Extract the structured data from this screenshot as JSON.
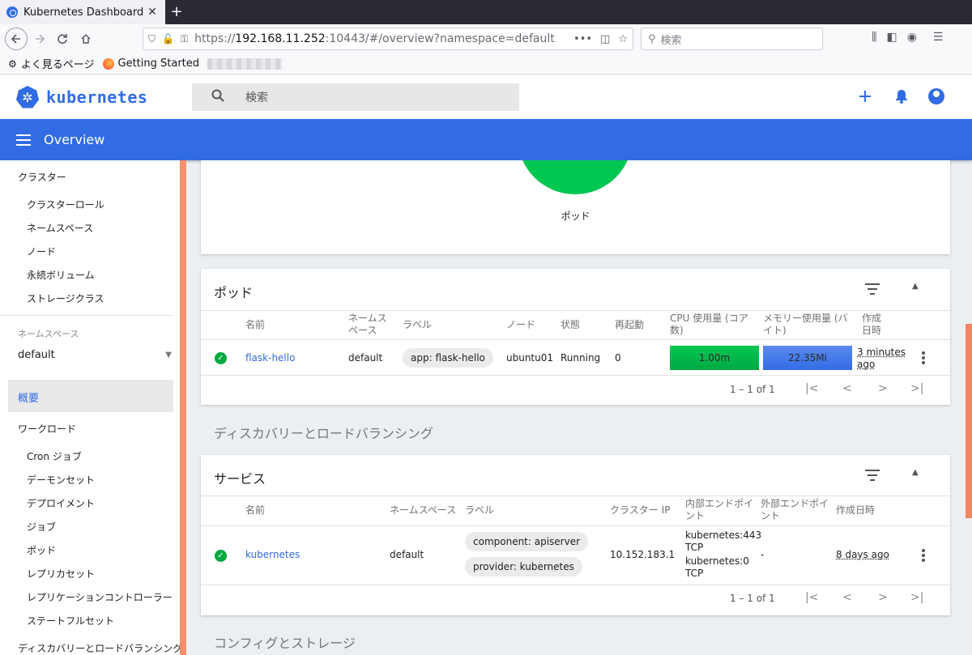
{
  "browser": {
    "tab_title": "Kubernetes Dashboard",
    "tab_close": "✕",
    "new_tab": "+",
    "url_prefix": "https://",
    "url_host": "192.168.11.252",
    "url_rest": ":10443/#/overview?namespace=default",
    "search_placeholder": "検索",
    "bookmarks": [
      "よく見るページ",
      "Getting Started"
    ]
  },
  "app": {
    "logo_text": "kubernetes",
    "search_placeholder": "検索",
    "toolbar_title": "Overview",
    "colors": {
      "primary": "#326ce5",
      "success": "#00c752",
      "accent_scroll": "#f4845f"
    }
  },
  "sidebar": {
    "cluster_heading": "クラスター",
    "cluster_items": [
      "クラスターロール",
      "ネームスペース",
      "ノード",
      "永続ボリューム",
      "ストレージクラス"
    ],
    "namespace_label": "ネームスペース",
    "namespace_value": "default",
    "active_item": "概要",
    "workload_heading": "ワークロード",
    "workload_items": [
      "Cron ジョブ",
      "デーモンセット",
      "デプロイメント",
      "ジョブ",
      "ポッド",
      "レプリカセット",
      "レプリケーションコントローラー",
      "ステートフルセット"
    ],
    "discovery_heading": "ディスカバリーとロードバランシング"
  },
  "chart": {
    "label": "ポッド"
  },
  "pods": {
    "title": "ポッド",
    "headers": {
      "name": "名前",
      "namespace_l1": "ネームス",
      "namespace_l2": "ペース",
      "labels": "ラベル",
      "node": "ノード",
      "status": "状態",
      "restarts": "再起動",
      "cpu_l1": "CPU 使用量 (コア",
      "cpu_l2": "数)",
      "mem_l1": "メモリー使用量 (バ",
      "mem_l2": "イト)",
      "created_l1": "作成",
      "created_l2": "日時"
    },
    "rows": [
      {
        "name": "flask-hello",
        "namespace": "default",
        "label": "app: flask-hello",
        "node": "ubuntu01",
        "status": "Running",
        "restarts": "0",
        "cpu": "1.00m",
        "memory": "22.35Mi",
        "age_l1": "3 minutes",
        "age_l2": "ago"
      }
    ],
    "pagination": "1 – 1 of 1"
  },
  "discovery_section_title": "ディスカバリーとロードバランシング",
  "services": {
    "title": "サービス",
    "headers": {
      "name": "名前",
      "namespace": "ネームスペース",
      "labels": "ラベル",
      "cluster_ip": "クラスター IP",
      "internal_l1": "内部エンドポイ",
      "internal_l2": "ント",
      "external_l1": "外部エンドポイ",
      "external_l2": "ント",
      "created": "作成日時"
    },
    "rows": [
      {
        "name": "kubernetes",
        "namespace": "default",
        "label_1": "component: apiserver",
        "label_2": "provider: kubernetes",
        "cluster_ip": "10.152.183.1",
        "internal_1a": "kubernetes:443",
        "internal_1b": "TCP",
        "internal_2a": "kubernetes:0",
        "internal_2b": "TCP",
        "external": "-",
        "age": "8 days ago"
      }
    ],
    "pagination": "1 – 1 of 1"
  },
  "config_section_title": "コンフィグとストレージ"
}
